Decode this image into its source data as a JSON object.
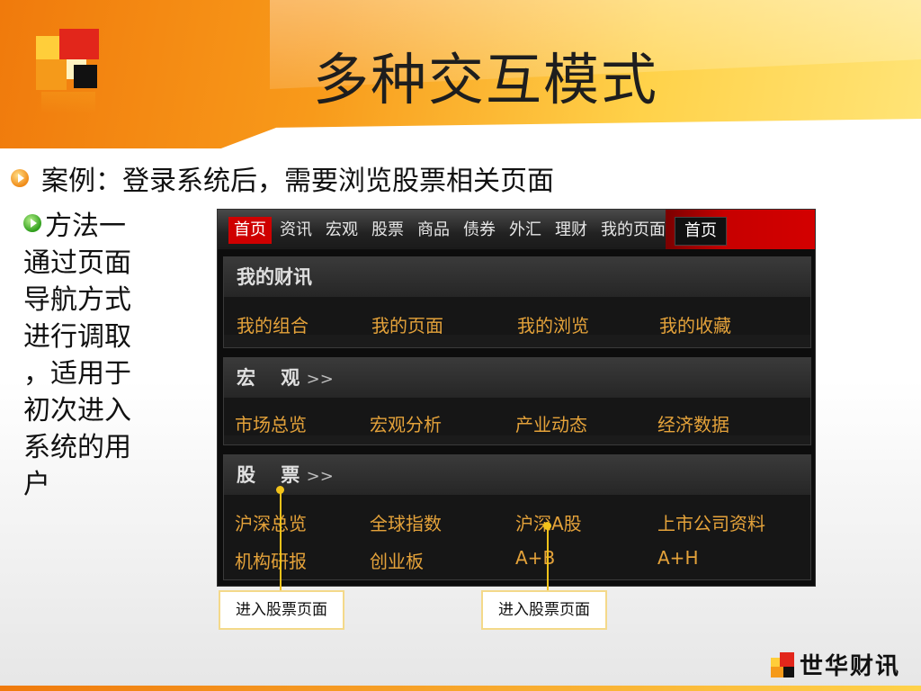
{
  "slide": {
    "title": "多种交互模式",
    "bullet1": "案例：登录系统后，需要浏览股票相关页面",
    "bullet2": "方法一",
    "desc_lines": [
      "通过页面",
      "导航方式",
      "进行调取",
      "，适用于",
      "初次进入",
      "系统的用",
      "户"
    ]
  },
  "app": {
    "nav": [
      "首页",
      "资讯",
      "宏观",
      "股票",
      "商品",
      "债券",
      "外汇",
      "理财",
      "我的页面"
    ],
    "nav_right": "首页",
    "panels": [
      {
        "title": "我的财讯",
        "arrows": "",
        "rows": [
          [
            "我的组合",
            "我的页面",
            "我的浏览",
            "我的收藏"
          ]
        ]
      },
      {
        "title": "宏　 观",
        "arrows": ">>",
        "rows": [
          [
            "市场总览",
            "宏观分析",
            "产业动态",
            "经济数据"
          ]
        ]
      },
      {
        "title": "股　 票",
        "arrows": ">>",
        "rows": [
          [
            "沪深总览",
            "全球指数",
            "沪深A股",
            "上市公司资料"
          ],
          [
            "机构研报",
            "创业板",
            "A+B",
            "A+H"
          ]
        ]
      }
    ]
  },
  "callouts": [
    "进入股票页面",
    "进入股票页面"
  ],
  "brand": "世华财讯",
  "colors": {
    "accent_orange": "#f08a16",
    "nav_red": "#cf0000",
    "link_gold": "#e4a23a",
    "callout_yellow": "#f2c21a"
  }
}
